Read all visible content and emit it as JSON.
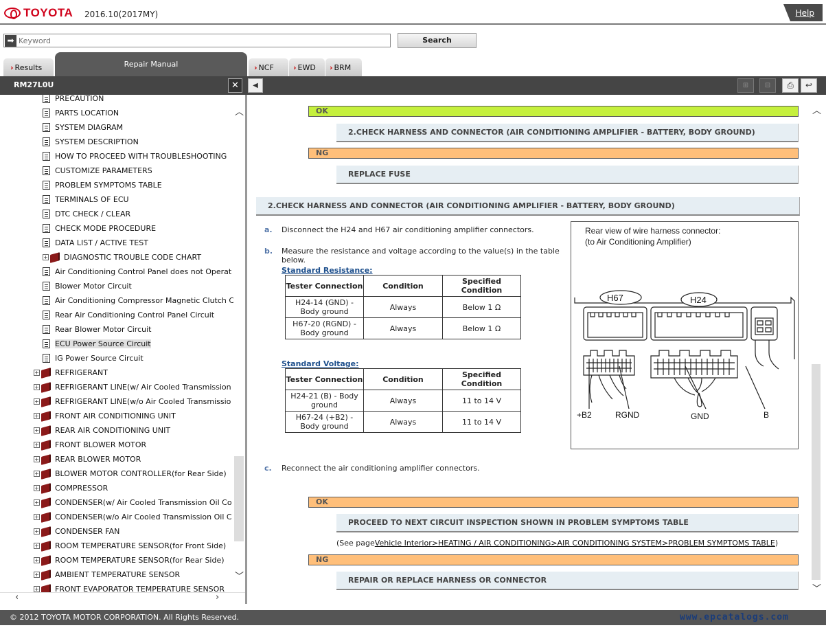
{
  "header": {
    "brand": "TOYOTA",
    "model_year": "2016.10(2017MY)",
    "help_label": "Help"
  },
  "search": {
    "placeholder": "Keyword",
    "button_label": "Search"
  },
  "tabs": [
    {
      "label": "Results"
    },
    {
      "label": "Repair Manual"
    },
    {
      "label": "NCF"
    },
    {
      "label": "EWD"
    },
    {
      "label": "BRM"
    }
  ],
  "toolbar": {
    "document_id": "RM27L0U",
    "close": "✕",
    "collapse": "◀"
  },
  "tree": {
    "items": [
      {
        "label": "PRECAUTION",
        "type": "doc"
      },
      {
        "label": "PARTS LOCATION",
        "type": "doc"
      },
      {
        "label": "SYSTEM DIAGRAM",
        "type": "doc"
      },
      {
        "label": "SYSTEM DESCRIPTION",
        "type": "doc"
      },
      {
        "label": "HOW TO PROCEED WITH TROUBLESHOOTING",
        "type": "doc"
      },
      {
        "label": "CUSTOMIZE PARAMETERS",
        "type": "doc"
      },
      {
        "label": "PROBLEM SYMPTOMS TABLE",
        "type": "doc"
      },
      {
        "label": "TERMINALS OF ECU",
        "type": "doc"
      },
      {
        "label": "DTC CHECK / CLEAR",
        "type": "doc"
      },
      {
        "label": "CHECK MODE PROCEDURE",
        "type": "doc"
      },
      {
        "label": "DATA LIST / ACTIVE TEST",
        "type": "doc"
      },
      {
        "label": "DIAGNOSTIC TROUBLE CODE CHART",
        "type": "book-sub"
      },
      {
        "label": "Air Conditioning Control Panel does not Operat",
        "type": "doc"
      },
      {
        "label": "Blower Motor Circuit",
        "type": "doc"
      },
      {
        "label": "Air Conditioning Compressor Magnetic Clutch C",
        "type": "doc"
      },
      {
        "label": "Rear Air Conditioning Control Panel Circuit",
        "type": "doc"
      },
      {
        "label": "Rear Blower Motor Circuit",
        "type": "doc"
      },
      {
        "label": "ECU Power Source Circuit",
        "type": "doc",
        "selected": true
      },
      {
        "label": "IG Power Source Circuit",
        "type": "doc"
      },
      {
        "label": "REFRIGERANT",
        "type": "book"
      },
      {
        "label": "REFRIGERANT LINE(w/ Air Cooled Transmission",
        "type": "book"
      },
      {
        "label": "REFRIGERANT LINE(w/o Air Cooled Transmissio",
        "type": "book"
      },
      {
        "label": "FRONT AIR CONDITIONING UNIT",
        "type": "book"
      },
      {
        "label": "REAR AIR CONDITIONING UNIT",
        "type": "book"
      },
      {
        "label": "FRONT BLOWER MOTOR",
        "type": "book"
      },
      {
        "label": "REAR BLOWER MOTOR",
        "type": "book"
      },
      {
        "label": "BLOWER MOTOR CONTROLLER(for Rear Side)",
        "type": "book"
      },
      {
        "label": "COMPRESSOR",
        "type": "book"
      },
      {
        "label": "CONDENSER(w/ Air Cooled Transmission Oil Co",
        "type": "book"
      },
      {
        "label": "CONDENSER(w/o Air Cooled Transmission Oil C",
        "type": "book"
      },
      {
        "label": "CONDENSER FAN",
        "type": "book"
      },
      {
        "label": "ROOM TEMPERATURE SENSOR(for Front Side)",
        "type": "book"
      },
      {
        "label": "ROOM TEMPERATURE SENSOR(for Rear Side)",
        "type": "book"
      },
      {
        "label": "AMBIENT TEMPERATURE SENSOR",
        "type": "book"
      },
      {
        "label": "FRONT EVAPORATOR TEMPERATURE SENSOR",
        "type": "book"
      }
    ]
  },
  "content": {
    "ok1": "OK",
    "step_link1": "2.CHECK HARNESS AND CONNECTOR (AIR CONDITIONING AMPLIFIER - BATTERY, BODY GROUND)",
    "ng1": "NG",
    "replace_fuse": "REPLACE FUSE",
    "section_title": "2.CHECK HARNESS AND CONNECTOR (AIR CONDITIONING AMPLIFIER - BATTERY, BODY GROUND)",
    "step_a": {
      "letter": "a.",
      "text": "Disconnect the H24 and H67 air conditioning amplifier connectors."
    },
    "step_b": {
      "letter": "b.",
      "text": "Measure the resistance and voltage according to the value(s) in the table below."
    },
    "resistance": {
      "heading": "Standard Resistance:",
      "headers": [
        "Tester Connection",
        "Condition",
        "Specified Condition"
      ],
      "rows": [
        [
          "H24-14 (GND) - Body ground",
          "Always",
          "Below 1 Ω"
        ],
        [
          "H67-20 (RGND) - Body ground",
          "Always",
          "Below 1 Ω"
        ]
      ]
    },
    "voltage": {
      "heading": "Standard Voltage:",
      "headers": [
        "Tester Connection",
        "Condition",
        "Specified Condition"
      ],
      "rows": [
        [
          "H24-21 (B) - Body ground",
          "Always",
          "11 to 14 V"
        ],
        [
          "H67-24 (+B2) - Body ground",
          "Always",
          "11 to 14 V"
        ]
      ]
    },
    "figure": {
      "caption1": "Rear view of wire harness connector:",
      "caption2": "(to Air Conditioning Amplifier)",
      "conn1": "H67",
      "conn2": "H24",
      "labels": [
        "+B2",
        "RGND",
        "GND",
        "B"
      ]
    },
    "step_c": {
      "letter": "c.",
      "text": "Reconnect the air conditioning amplifier connectors."
    },
    "ok2": "OK",
    "proceed": "PROCEED TO NEXT CIRCUIT INSPECTION SHOWN IN PROBLEM SYMPTOMS TABLE",
    "see_page_prefix": "(See page",
    "see_page_link": "Vehicle Interior>HEATING / AIR CONDITIONING>AIR CONDITIONING SYSTEM>PROBLEM SYMPTOMS TABLE",
    "see_page_suffix": ")",
    "ng2": "NG",
    "repair": "REPAIR OR REPLACE HARNESS OR CONNECTOR"
  },
  "footer": {
    "copyright": "© 2012 TOYOTA MOTOR CORPORATION. All Rights Reserved.",
    "watermark": "www.epcatalogs.com"
  },
  "colors": {
    "ok": "#c5f03d",
    "ng": "#ffbf7a",
    "brand": "#d0021b"
  }
}
